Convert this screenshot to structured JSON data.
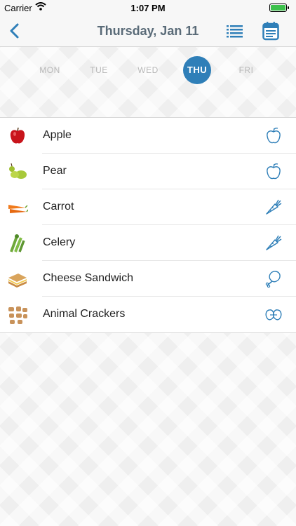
{
  "status_bar": {
    "carrier": "Carrier",
    "time": "1:07 PM"
  },
  "nav": {
    "title": "Thursday, Jan 11",
    "accent": "#2f7fb8"
  },
  "days": [
    {
      "label": "MON",
      "selected": false
    },
    {
      "label": "TUE",
      "selected": false
    },
    {
      "label": "WED",
      "selected": false
    },
    {
      "label": "THU",
      "selected": true
    },
    {
      "label": "FRI",
      "selected": false
    }
  ],
  "foods": [
    {
      "name": "Apple",
      "image": "apple-photo",
      "category_icon": "apple-icon"
    },
    {
      "name": "Pear",
      "image": "pear-photo",
      "category_icon": "apple-icon"
    },
    {
      "name": "Carrot",
      "image": "carrot-photo",
      "category_icon": "carrot-icon"
    },
    {
      "name": "Celery",
      "image": "celery-photo",
      "category_icon": "carrot-icon"
    },
    {
      "name": "Cheese Sandwich",
      "image": "sandwich-photo",
      "category_icon": "drumstick-icon"
    },
    {
      "name": "Animal Crackers",
      "image": "crackers-photo",
      "category_icon": "pretzel-icon"
    }
  ]
}
